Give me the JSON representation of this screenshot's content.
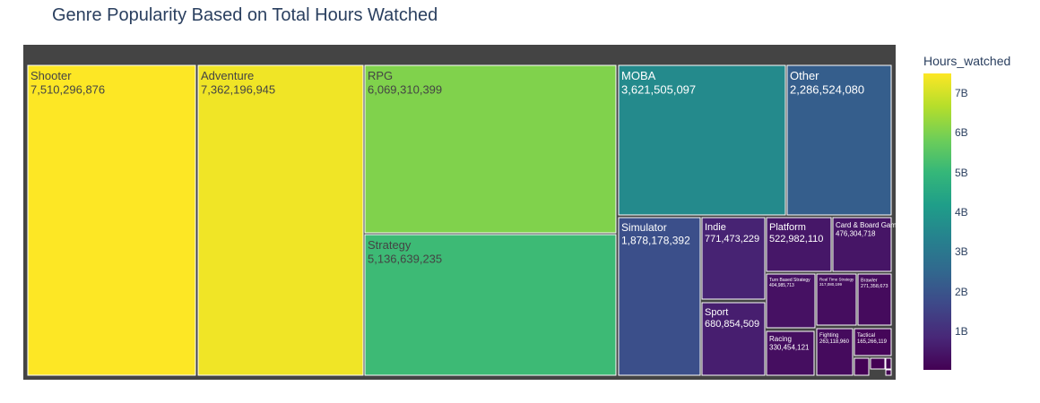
{
  "chart_data": {
    "type": "treemap",
    "title": "Genre Popularity Based on Total Hours Watched",
    "colorbar": {
      "title": "Hours_watched",
      "ticks": [
        "1B",
        "2B",
        "3B",
        "4B",
        "5B",
        "6B",
        "7B"
      ],
      "tick_values": [
        1000000000,
        2000000000,
        3000000000,
        4000000000,
        5000000000,
        6000000000,
        7000000000
      ],
      "range": [
        60000000,
        7510296876
      ],
      "colorscale": [
        "#440154",
        "#482878",
        "#3e4989",
        "#31688e",
        "#26828e",
        "#1f9e89",
        "#35b779",
        "#6ece58",
        "#b5de2b",
        "#fde725"
      ]
    },
    "nodes": [
      {
        "label": "Shooter",
        "value": 7510296876,
        "text": "7,510,296,876"
      },
      {
        "label": "Adventure",
        "value": 7362196945,
        "text": "7,362,196,945"
      },
      {
        "label": "RPG",
        "value": 6069310399,
        "text": "6,069,310,399"
      },
      {
        "label": "Strategy",
        "value": 5136639235,
        "text": "5,136,639,235"
      },
      {
        "label": "MOBA",
        "value": 3621505097,
        "text": "3,621,505,097"
      },
      {
        "label": "Other",
        "value": 2286524080,
        "text": "2,286,524,080"
      },
      {
        "label": "Simulator",
        "value": 1878178392,
        "text": "1,878,178,392"
      },
      {
        "label": "Indie",
        "value": 771473229,
        "text": "771,473,229"
      },
      {
        "label": "Sport",
        "value": 680854509,
        "text": "680,854,509"
      },
      {
        "label": "Platform",
        "value": 522982110,
        "text": "522,982,110"
      },
      {
        "label": "Card & Board Game",
        "value": 476304718,
        "text": "476,304,718"
      },
      {
        "label": "Turn Based Strategy",
        "value": 404985713,
        "text": "404,985,713"
      },
      {
        "label": "Real Time Strategy",
        "value": 317080199,
        "text": "317,080,199"
      },
      {
        "label": "Brawler",
        "value": 271358673,
        "text": "271,358,673"
      },
      {
        "label": "Racing",
        "value": 330454121,
        "text": "330,454,121"
      },
      {
        "label": "Fighting",
        "value": 263118960,
        "text": "263,118,960"
      },
      {
        "label": "Tactical",
        "value": 165266119,
        "text": "165,266,119"
      },
      {
        "label": "",
        "value": 90000000,
        "text": ""
      },
      {
        "label": "",
        "value": 70000000,
        "text": ""
      },
      {
        "label": "",
        "value": 60000000,
        "text": ""
      },
      {
        "label": "",
        "value": 30000000,
        "text": ""
      }
    ]
  }
}
